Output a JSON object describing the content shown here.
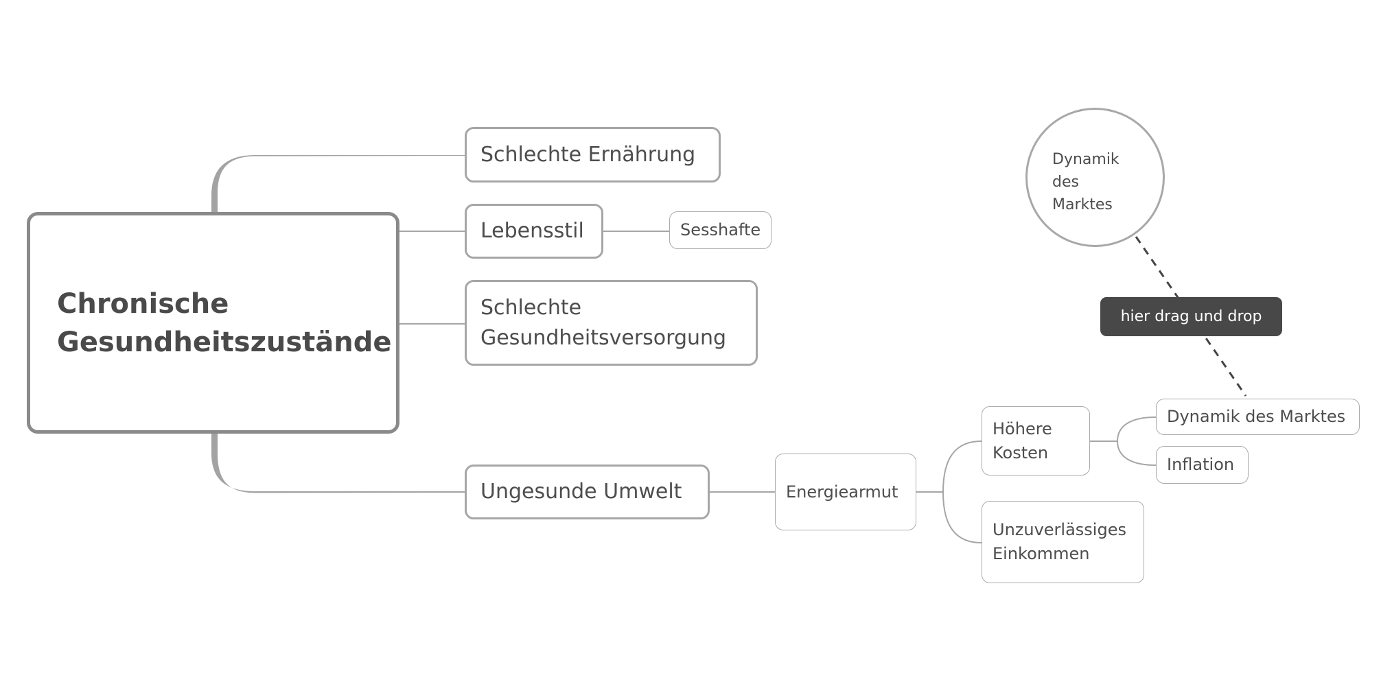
{
  "mindmap": {
    "central_topic": "Chronische\nGesundheitszustände",
    "branches": {
      "ernaehrung": "Schlechte Ernährung",
      "lebensstil": "Lebensstil",
      "sesshafte": "Sesshafte",
      "versorgung": "Schlechte\nGesundheitsversorgung",
      "umwelt": "Ungesunde Umwelt",
      "energiearmut": "Energiearmut",
      "hoehere_kosten": "Höhere\nKosten",
      "einkommen": "Unzuverlässiges\nEinkommen",
      "dynamik": "Dynamik des Marktes",
      "inflation": "Inflation"
    },
    "floating_topic": "Dynamik\ndes\nMarktes",
    "relationship_label": "hier drag und drop"
  },
  "colors": {
    "line": "#a6a6a6",
    "central_border": "#8a8a8a",
    "label_bg": "#484848",
    "text": "#4b4b4b"
  }
}
